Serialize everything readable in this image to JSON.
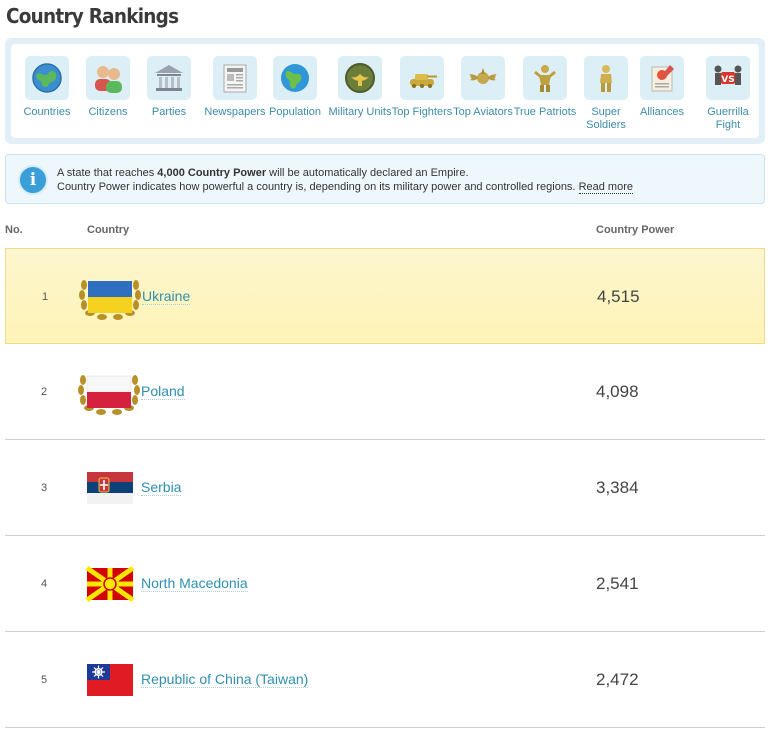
{
  "page": {
    "title": "Country Rankings"
  },
  "categories": [
    {
      "label": "Countries",
      "icon": "globe-icon"
    },
    {
      "label": "Citizens",
      "icon": "citizens-icon"
    },
    {
      "label": "Parties",
      "icon": "parliament-icon"
    },
    {
      "label": "Newspapers",
      "icon": "newspaper-icon"
    },
    {
      "label": "Population",
      "icon": "population-globe-icon"
    },
    {
      "label": "Military Units",
      "icon": "military-badge-icon"
    },
    {
      "label": "Top Fighters",
      "icon": "tank-icon"
    },
    {
      "label": "Top Aviators",
      "icon": "aviator-wings-icon"
    },
    {
      "label": "True Patriots",
      "icon": "patriot-soldier-icon"
    },
    {
      "label": "Super Soldiers",
      "icon": "super-soldier-icon"
    },
    {
      "label": "Alliances",
      "icon": "alliance-scroll-icon"
    },
    {
      "label": "Guerrilla Fight",
      "icon": "versus-icon"
    }
  ],
  "info": {
    "line1_pre": "A state that reaches ",
    "line1_bold": "4,000 Country Power",
    "line1_post": " will be automatically declared an Empire.",
    "line2": "Country Power indicates how powerful a country is, depending on its military power and controlled regions. ",
    "read_more": "Read more"
  },
  "table": {
    "headers": {
      "no": "No.",
      "country": "Country",
      "power": "Country Power"
    },
    "rows": [
      {
        "no": "1",
        "country": "Ukraine",
        "power": "4,515",
        "flag": "ukraine",
        "wreath": true
      },
      {
        "no": "2",
        "country": "Poland",
        "power": "4,098",
        "flag": "poland",
        "wreath": true
      },
      {
        "no": "3",
        "country": "Serbia",
        "power": "3,384",
        "flag": "serbia",
        "wreath": false
      },
      {
        "no": "4",
        "country": "North Macedonia",
        "power": "2,541",
        "flag": "north-macedonia",
        "wreath": false
      },
      {
        "no": "5",
        "country": "Republic of China (Taiwan)",
        "power": "2,472",
        "flag": "taiwan",
        "wreath": false
      }
    ]
  },
  "colors": {
    "accent_link": "#2f8fb1",
    "highlight_row": "#fef3b6",
    "panel_bg": "#e2eff7"
  }
}
